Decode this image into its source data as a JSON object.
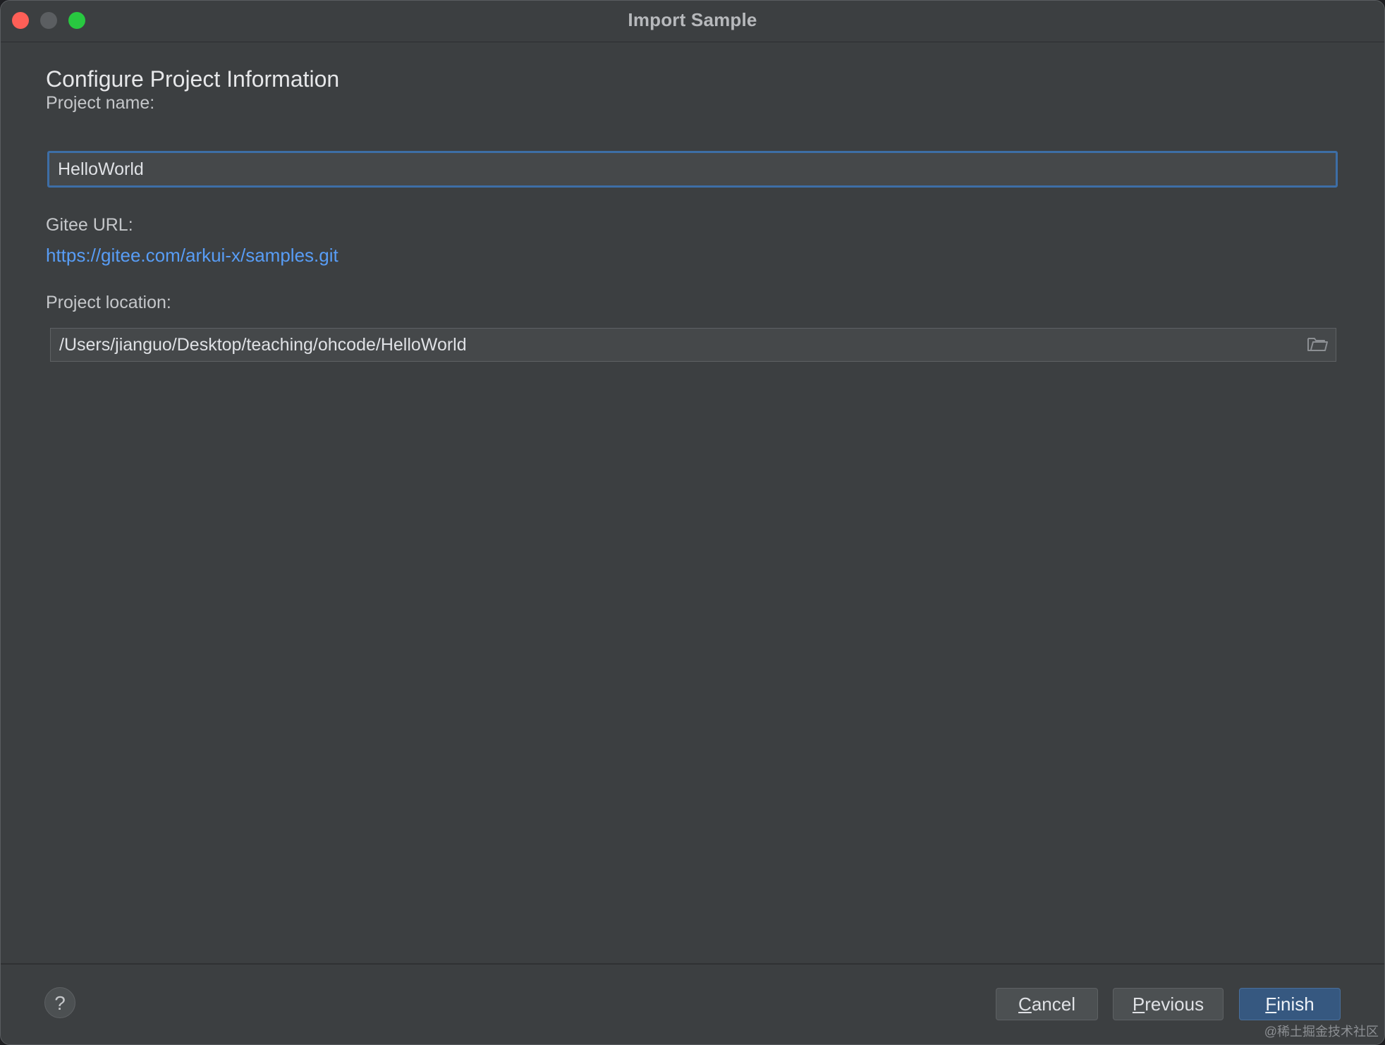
{
  "window": {
    "title": "Import Sample"
  },
  "form": {
    "heading": "Configure Project Information",
    "project_name_label": "Project name:",
    "project_name_value": "HelloWorld",
    "gitee_url_label": "Gitee URL:",
    "gitee_url": "https://gitee.com/arkui-x/samples.git",
    "project_location_label": "Project location:",
    "project_location_value": "/Users/jianguo/Desktop/teaching/ohcode/HelloWorld"
  },
  "footer": {
    "help_label": "?",
    "cancel_mnemonic": "C",
    "cancel_rest": "ancel",
    "previous_mnemonic": "P",
    "previous_rest": "revious",
    "finish_mnemonic": "F",
    "finish_rest": "inish"
  },
  "watermark": "@稀土掘金技术社区",
  "colors": {
    "accent": "#3d6ea6",
    "link": "#589df6",
    "primary_button": "#365880",
    "close": "#fe5f57",
    "maximize": "#28c840"
  },
  "icons": {
    "location_browse": "folder-icon"
  }
}
